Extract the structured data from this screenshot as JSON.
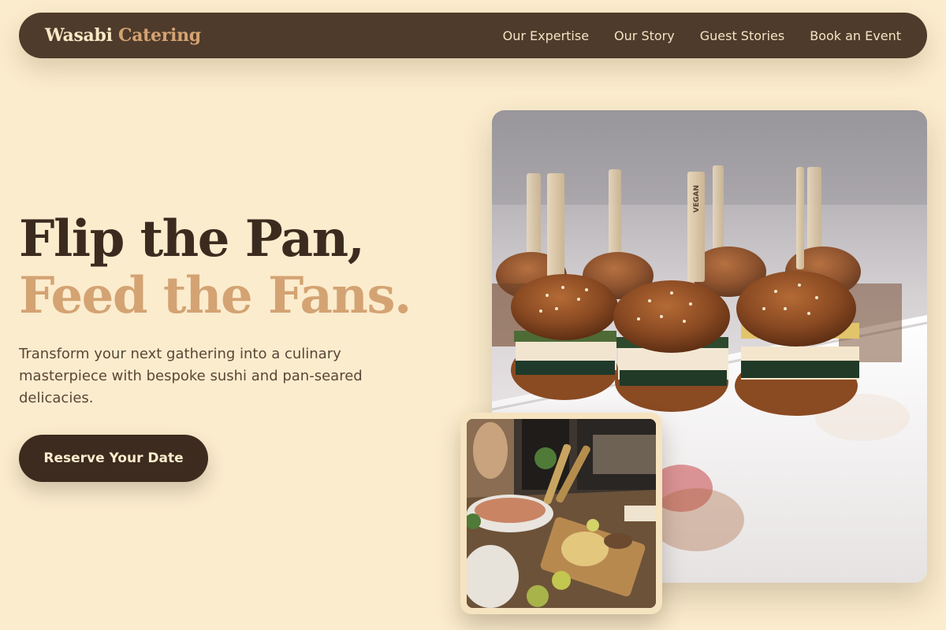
{
  "brand": {
    "name": "Wasabi",
    "accent": "Catering"
  },
  "nav": {
    "links": [
      "Our Expertise",
      "Our Story",
      "Guest Stories",
      "Book an Event"
    ]
  },
  "hero": {
    "headline_line1": "Flip the Pan,",
    "headline_line2": "Feed the Fans.",
    "subtitle": "Transform your next gathering into a culinary masterpiece with bespoke sushi and pan-seared delicacies.",
    "cta_label": "Reserve Your Date"
  },
  "photos": {
    "main_alt": "Vegan sliders on wooden skewers",
    "inset_alt": "Catering buffet table spread",
    "pick_label": "VEGAN"
  },
  "colors": {
    "background": "#fbeccd",
    "nav": "#4f3b2b",
    "dark_brown": "#3b2b1f",
    "accent_tan": "#d4a373"
  }
}
